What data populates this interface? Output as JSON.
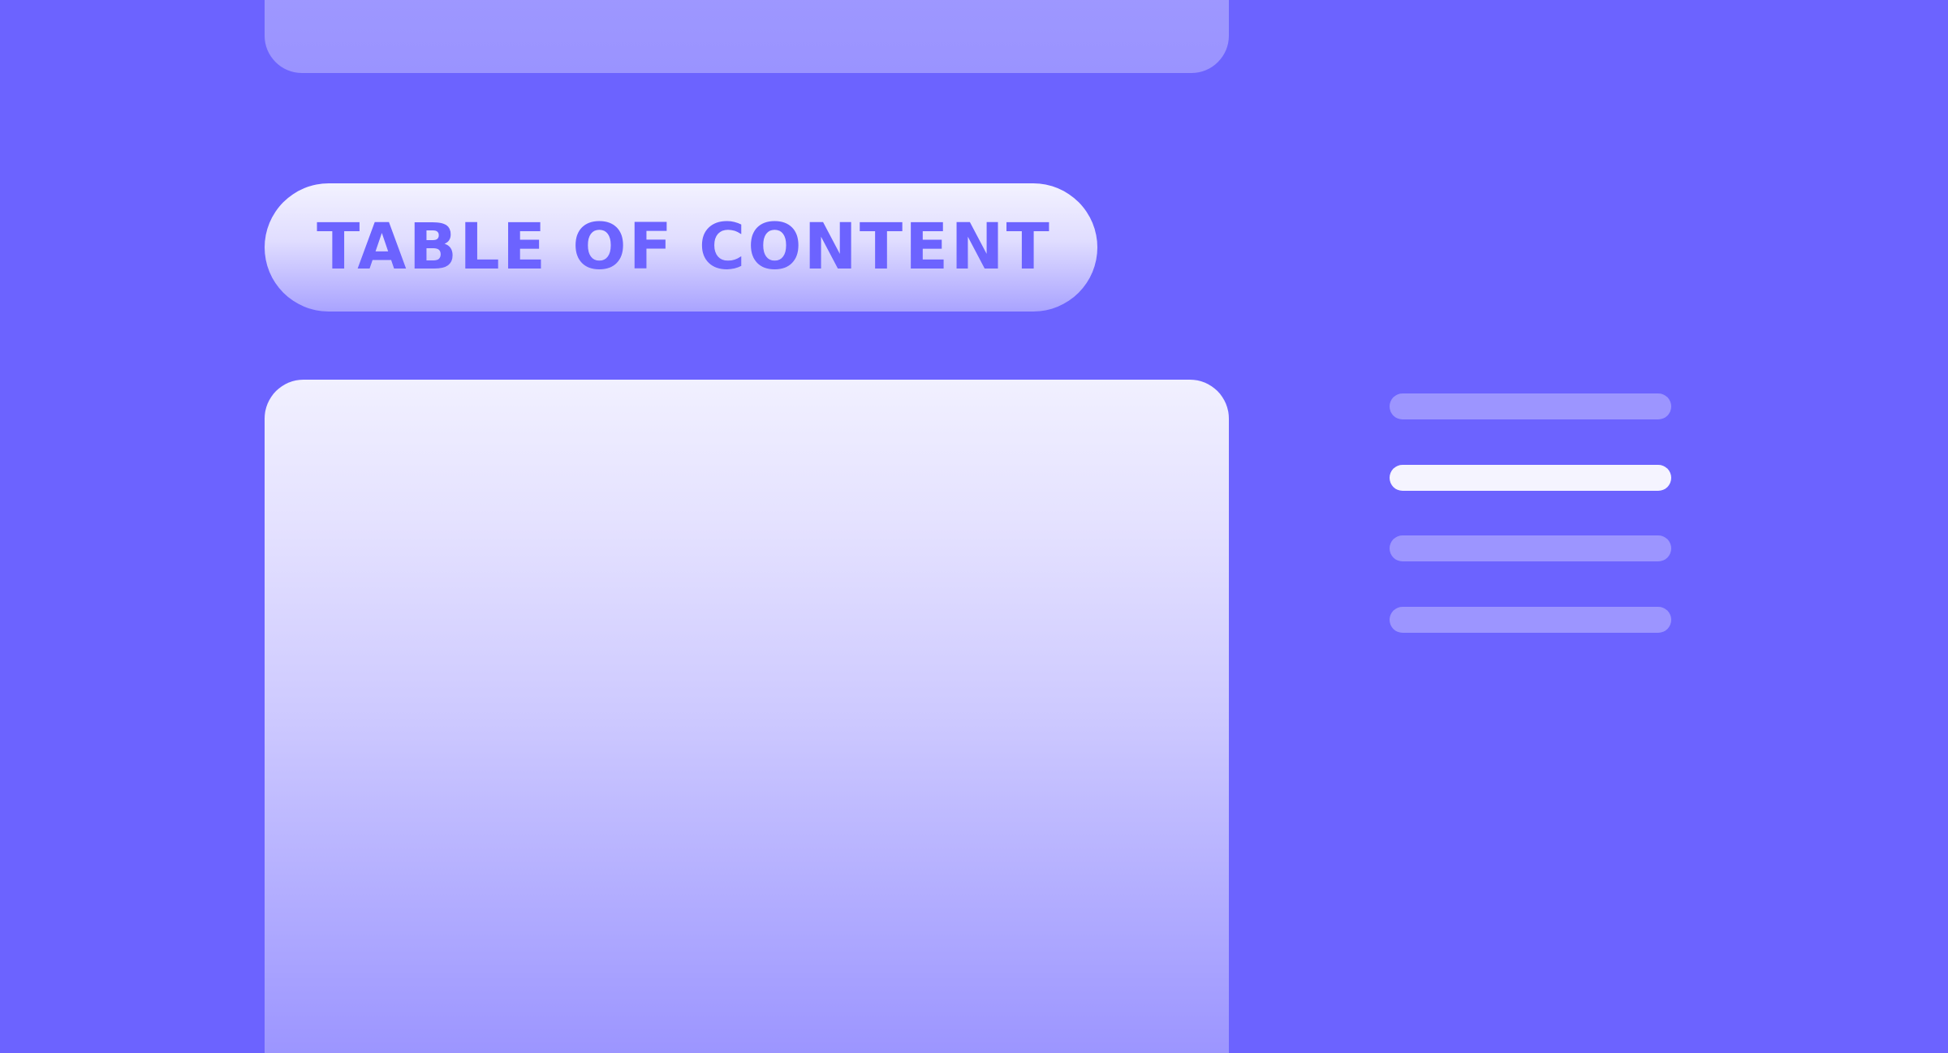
{
  "toc": {
    "title": "TABLE OF CONTENT",
    "items": [
      {
        "active": false
      },
      {
        "active": true
      },
      {
        "active": false
      },
      {
        "active": false
      }
    ]
  },
  "colors": {
    "background": "#6c63ff",
    "accent_text": "#6c63ff",
    "line_inactive": "#9c95ff",
    "line_active": "#f5f4ff"
  }
}
